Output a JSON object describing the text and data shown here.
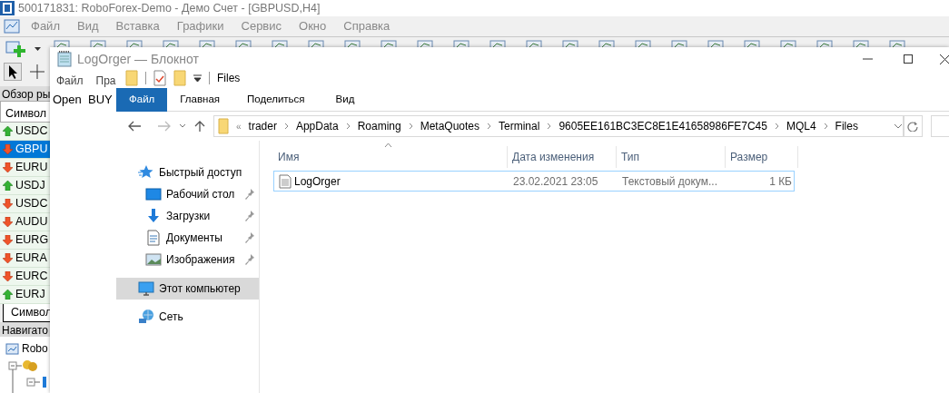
{
  "terminal": {
    "title": "500171831: RoboForex-Demo - Демо Счет - [GBPUSD,H4]",
    "menu": [
      "Файл",
      "Вид",
      "Вставка",
      "Графики",
      "Сервис",
      "Окно",
      "Справка"
    ],
    "market_watch": {
      "title": "Обзор ры",
      "column": "Символ",
      "tab": "Символ",
      "rows": [
        {
          "symbol": "USDC",
          "kind": "up",
          "selected": false
        },
        {
          "symbol": "GBPU",
          "kind": "down",
          "selected": true
        },
        {
          "symbol": "EURU",
          "kind": "down",
          "selected": false
        },
        {
          "symbol": "USDJ",
          "kind": "up",
          "selected": false
        },
        {
          "symbol": "USDC",
          "kind": "down",
          "selected": false
        },
        {
          "symbol": "AUDU",
          "kind": "down",
          "selected": false
        },
        {
          "symbol": "EURG",
          "kind": "down",
          "selected": false
        },
        {
          "symbol": "EURA",
          "kind": "down",
          "selected": false
        },
        {
          "symbol": "EURC",
          "kind": "down",
          "selected": false
        },
        {
          "symbol": "EURJ",
          "kind": "up",
          "selected": false
        }
      ]
    },
    "navigator": {
      "title": "Навигато",
      "items": [
        {
          "label": "Robo"
        }
      ]
    }
  },
  "notepad": {
    "title": "LogOrger — Блокнот",
    "menu": [
      "Файл",
      "Пра"
    ],
    "text": "Open  BUY"
  },
  "explorer": {
    "title": "Files",
    "ribbon_tabs": [
      {
        "label": "Файл",
        "selected": true
      },
      {
        "label": "Главная",
        "selected": false
      },
      {
        "label": "Поделиться",
        "selected": false
      },
      {
        "label": "Вид",
        "selected": false
      }
    ],
    "path_prefix": "«",
    "path": [
      "trader",
      "AppData",
      "Roaming",
      "MetaQuotes",
      "Terminal",
      "9605EE161BC3EC8E1E41658986FE7C45",
      "MQL4",
      "Files"
    ],
    "nav_items": [
      {
        "label": "Быстрый доступ",
        "kind": "star",
        "selected": false,
        "children": [
          {
            "label": "Рабочий стол",
            "kind": "desktop",
            "pinned": true,
            "selected": false
          },
          {
            "label": "Загрузки",
            "kind": "download",
            "pinned": true,
            "selected": false
          },
          {
            "label": "Документы",
            "kind": "document",
            "pinned": true,
            "selected": false
          },
          {
            "label": "Изображения",
            "kind": "image",
            "pinned": true,
            "selected": false
          }
        ]
      },
      {
        "label": "Этот компьютер",
        "kind": "computer",
        "selected": true
      },
      {
        "label": "Сеть",
        "kind": "network",
        "selected": false
      }
    ],
    "columns": [
      "Имя",
      "Дата изменения",
      "Тип",
      "Размер"
    ],
    "files": [
      {
        "name": "LogOrger",
        "date": "23.02.2021 23:05",
        "type": "Текстовый докум...",
        "size": "1 КБ",
        "selected": true
      }
    ]
  }
}
